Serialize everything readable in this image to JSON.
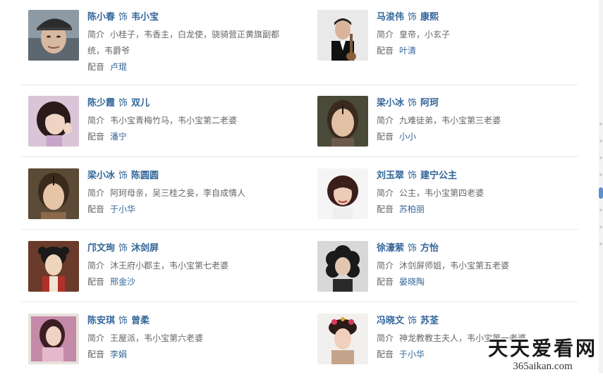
{
  "labels": {
    "role_sep": "饰",
    "intro_key": "简介",
    "voice_key": "配音"
  },
  "cast": [
    {
      "actor": "陈小春",
      "role": "韦小宝",
      "intro": "小桂子，韦香主，白龙使，骁骑营正黄旗副都统，韦爵爷",
      "voice": "卢琨",
      "avatar": "man-cap"
    },
    {
      "actor": "马浚伟",
      "role": "康熙",
      "intro": "皇帝，小玄子",
      "voice": "叶清",
      "avatar": "man-suit"
    },
    {
      "actor": "陈少霞",
      "role": "双儿",
      "intro": "韦小宝青梅竹马，韦小宝第二老婆",
      "voice": "潘宁",
      "avatar": "woman-short-hair"
    },
    {
      "actor": "梁小冰",
      "role": "阿珂",
      "intro": "九难徒弟，韦小宝第三老婆",
      "voice": "小小",
      "avatar": "woman-center-part"
    },
    {
      "actor": "梁小冰",
      "role": "陈圆圆",
      "intro": "阿珂母亲，吴三桂之妾，李自成情人",
      "voice": "于小华",
      "avatar": "woman-center-part"
    },
    {
      "actor": "刘玉翠",
      "role": "建宁公主",
      "intro": "公主，韦小宝第四老婆",
      "voice": "苏柏丽",
      "avatar": "woman-bob"
    },
    {
      "actor": "邝文珣",
      "role": "沐剑屏",
      "intro": "沐王府小郡主，韦小宝第七老婆",
      "voice": "邢金沙",
      "avatar": "woman-costume"
    },
    {
      "actor": "徐濠萦",
      "role": "方怡",
      "intro": "沐剑屏师姐，韦小宝第五老婆",
      "voice": "晏晓陶",
      "avatar": "woman-curly"
    },
    {
      "actor": "陈安琪",
      "role": "曾柔",
      "intro": "王屋派，韦小宝第六老婆",
      "voice": "李娟",
      "avatar": "woman-long-hair"
    },
    {
      "actor": "冯晓文",
      "role": "苏荃",
      "intro": "神龙教教主夫人，韦小宝第一老婆",
      "voice": "于小华",
      "avatar": "woman-headdress"
    }
  ],
  "watermark": {
    "cn": "天天爱看网",
    "en": "365aikan.com"
  }
}
